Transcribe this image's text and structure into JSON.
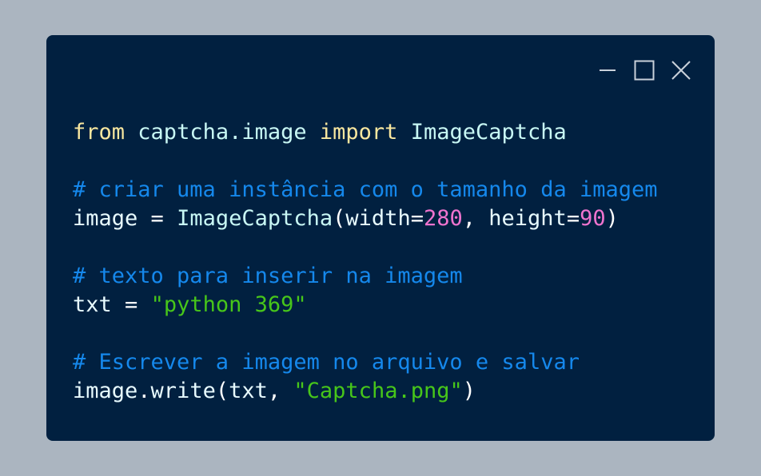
{
  "window_controls": {
    "minimize_icon": "minimize-icon",
    "maximize_icon": "maximize-icon",
    "close_icon": "close-icon"
  },
  "code": {
    "line1": {
      "kw_from": "from",
      "module": "captcha.image",
      "kw_import": "import",
      "cls": "ImageCaptcha"
    },
    "line3": {
      "comment": "# criar uma instância com o tamanho da imagem"
    },
    "line4": {
      "var": "image",
      "eq": "=",
      "cls": "ImageCaptcha",
      "open": "(",
      "arg1": "width",
      "eq1": "=",
      "val1": "280",
      "comma": ",",
      "arg2": "height",
      "eq2": "=",
      "val2": "90",
      "close": ")"
    },
    "line6": {
      "comment": "# texto para inserir na imagem"
    },
    "line7": {
      "var": "txt",
      "eq": "=",
      "str": "\"python 369\""
    },
    "line9": {
      "comment": "# Escrever a imagem no arquivo e salvar"
    },
    "line10": {
      "obj": "image",
      "dot": ".",
      "method": "write",
      "open": "(",
      "arg": "txt",
      "comma": ",",
      "str": "\"Captcha.png\"",
      "close": ")"
    }
  }
}
